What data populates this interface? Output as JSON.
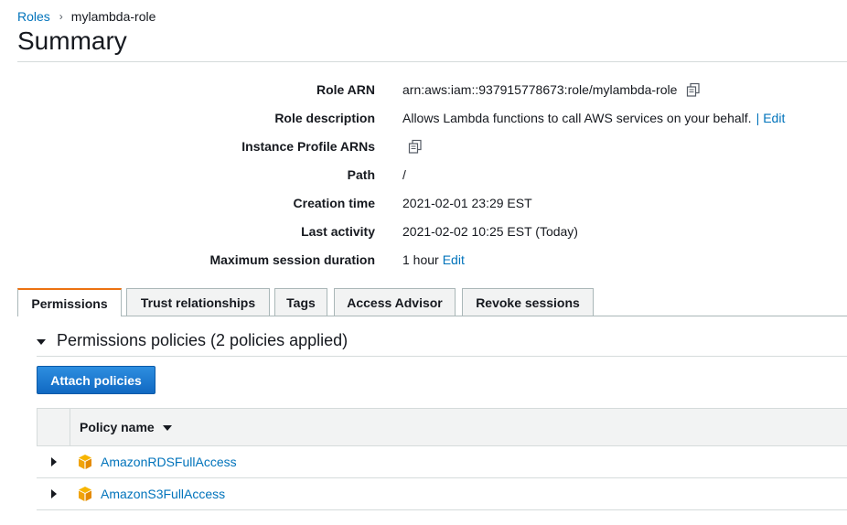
{
  "breadcrumb": {
    "parent": "Roles",
    "separator": "›",
    "current": "mylambda-role"
  },
  "page": {
    "title": "Summary"
  },
  "summary": {
    "role_arn": {
      "label": "Role ARN",
      "value": "arn:aws:iam::937915778673:role/mylambda-role"
    },
    "role_description": {
      "label": "Role description",
      "value": "Allows Lambda functions to call AWS services on your behalf.",
      "separator": "|",
      "edit": "Edit"
    },
    "instance_profile_arns": {
      "label": "Instance Profile ARNs"
    },
    "path": {
      "label": "Path",
      "value": "/"
    },
    "creation_time": {
      "label": "Creation time",
      "value": "2021-02-01 23:29 EST"
    },
    "last_activity": {
      "label": "Last activity",
      "value": "2021-02-02 10:25 EST (Today)"
    },
    "max_session": {
      "label": "Maximum session duration",
      "value": "1 hour",
      "edit": "Edit"
    }
  },
  "tabs": [
    {
      "label": "Permissions",
      "active": true
    },
    {
      "label": "Trust relationships",
      "active": false
    },
    {
      "label": "Tags",
      "active": false
    },
    {
      "label": "Access Advisor",
      "active": false
    },
    {
      "label": "Revoke sessions",
      "active": false
    }
  ],
  "permissions": {
    "section_title": "Permissions policies (2 policies applied)",
    "attach_button": "Attach policies",
    "column_policy_name": "Policy name",
    "policies": [
      {
        "name": "AmazonRDSFullAccess"
      },
      {
        "name": "AmazonS3FullAccess"
      }
    ]
  },
  "colors": {
    "link": "#0073bb",
    "primary_button": "#1a7bd6",
    "active_tab_accent": "#ec7211",
    "aws_managed_icon": "#f0a30a"
  },
  "icons": {
    "copy": "copy-icon",
    "policy": "aws-managed-policy-icon"
  }
}
